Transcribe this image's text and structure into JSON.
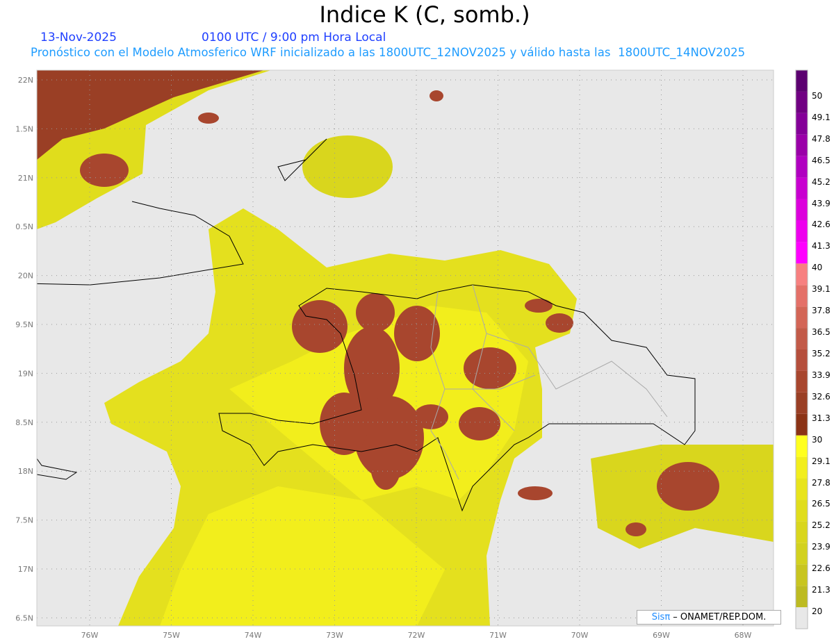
{
  "title": "Indice K (C, somb.)",
  "date": "13-Nov-2025",
  "time": "0100 UTC / 9:00 pm Hora Local",
  "subtitle": "Pronóstico con el Modelo Atmosferico WRF inicializado a las 1800UTC_12NOV2025 y válido hasta las  1800UTC_14NOV2025",
  "lon_labels": [
    "76W",
    "75W",
    "74W",
    "73W",
    "72W",
    "71W",
    "70W",
    "69W",
    "68W"
  ],
  "lat_labels": [
    "22N",
    "1.5N",
    "21N",
    "0.5N",
    "20N",
    "9.5N",
    "19N",
    "8.5N",
    "18N",
    "7.5N",
    "17N",
    "6.5N"
  ],
  "colorbar": {
    "labels": [
      "50",
      "49.1",
      "47.8",
      "46.5",
      "45.2",
      "43.9",
      "42.6",
      "41.3",
      "40",
      "39.1",
      "37.8",
      "36.5",
      "35.2",
      "33.9",
      "32.6",
      "31.3",
      "30",
      "29.1",
      "27.8",
      "26.5",
      "25.2",
      "23.9",
      "22.6",
      "21.3",
      "20"
    ],
    "colors_bottom_to_top": [
      "#e8e8e8",
      "#bdbb22",
      "#c8c520",
      "#d2d11f",
      "#d9d61d",
      "#e0dd1c",
      "#e8e41c",
      "#f2ee1c",
      "#ffff1f",
      "#8b3316",
      "#9a3f25",
      "#a8462e",
      "#b54f3c",
      "#c25a48",
      "#d36556",
      "#e47068",
      "#f78080",
      "#ff00ff",
      "#ee00ee",
      "#dc00dc",
      "#c800d0",
      "#b000c0",
      "#9a00a8",
      "#840098",
      "#700082",
      "#5c0070"
    ]
  },
  "credit": {
    "brand": "Sisπ",
    "text": " –  ONAMET/REP.DOM."
  }
}
